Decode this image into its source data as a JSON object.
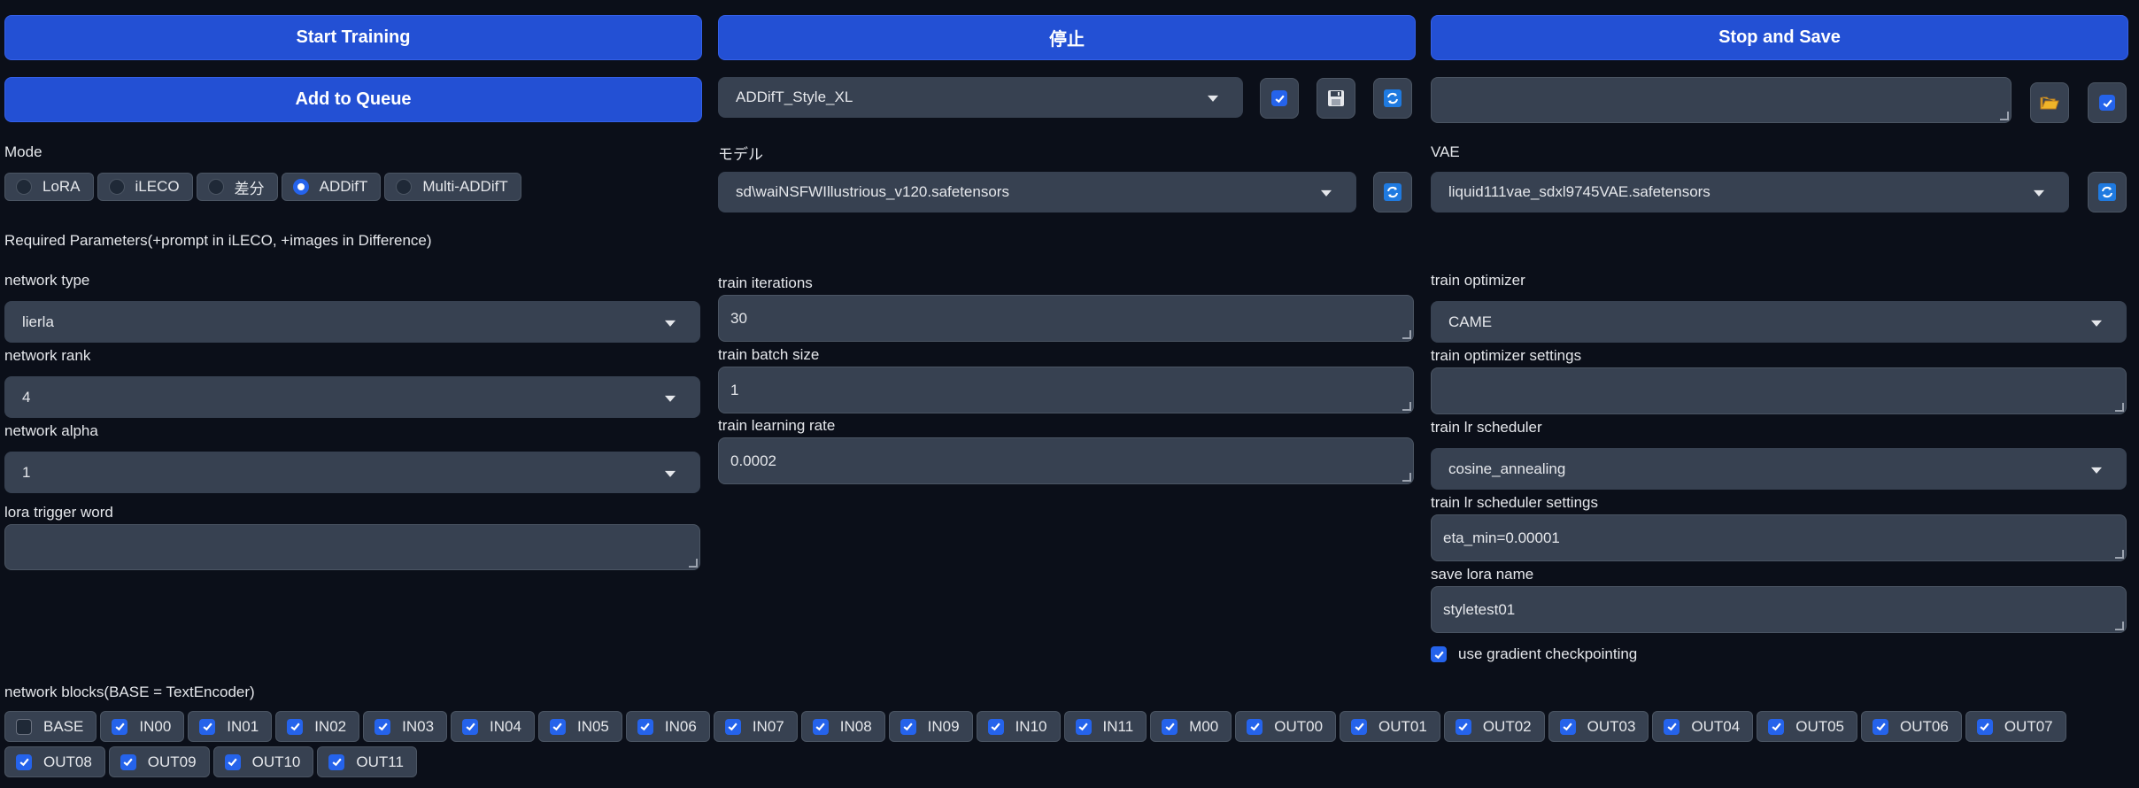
{
  "top_buttons": {
    "start": "Start Training",
    "stop": "停止",
    "stop_save": "Stop and Save",
    "queue": "Add to Queue"
  },
  "preset": {
    "value": "ADDifT_Style_XL"
  },
  "preset_text": {
    "value": ""
  },
  "mode": {
    "label": "Mode",
    "options": [
      "LoRA",
      "iLECO",
      "差分",
      "ADDifT",
      "Multi-ADDifT"
    ],
    "selected": "ADDifT"
  },
  "model": {
    "label": "モデル",
    "value": "sd\\waiNSFWIllustrious_v120.safetensors"
  },
  "vae": {
    "label": "VAE",
    "value": "liquid111vae_sdxl9745VAE.safetensors"
  },
  "required_heading": "Required Parameters(+prompt in iLECO, +images in Difference)",
  "left": {
    "network_type": {
      "label": "network type",
      "value": "lierla"
    },
    "network_rank": {
      "label": "network rank",
      "value": "4"
    },
    "network_alpha": {
      "label": "network alpha",
      "value": "1"
    },
    "lora_trigger": {
      "label": "lora trigger word",
      "value": ""
    }
  },
  "middle": {
    "iterations": {
      "label": "train iterations",
      "value": "30"
    },
    "batch": {
      "label": "train batch size",
      "value": "1"
    },
    "lr": {
      "label": "train learning rate",
      "value": "0.0002"
    }
  },
  "right": {
    "optimizer": {
      "label": "train optimizer",
      "value": "CAME"
    },
    "optimizer_settings": {
      "label": "train optimizer settings",
      "value": ""
    },
    "scheduler": {
      "label": "train lr scheduler",
      "value": "cosine_annealing"
    },
    "scheduler_settings": {
      "label": "train lr scheduler settings",
      "value": "eta_min=0.00001"
    },
    "save_name": {
      "label": "save lora name",
      "value": "styletest01"
    },
    "gradient_ckpt": {
      "label": "use gradient checkpointing",
      "checked": true
    }
  },
  "blocks": {
    "label": "network blocks(BASE = TextEncoder)",
    "items": [
      {
        "name": "BASE",
        "checked": false
      },
      {
        "name": "IN00",
        "checked": true
      },
      {
        "name": "IN01",
        "checked": true
      },
      {
        "name": "IN02",
        "checked": true
      },
      {
        "name": "IN03",
        "checked": true
      },
      {
        "name": "IN04",
        "checked": true
      },
      {
        "name": "IN05",
        "checked": true
      },
      {
        "name": "IN06",
        "checked": true
      },
      {
        "name": "IN07",
        "checked": true
      },
      {
        "name": "IN08",
        "checked": true
      },
      {
        "name": "IN09",
        "checked": true
      },
      {
        "name": "IN10",
        "checked": true
      },
      {
        "name": "IN11",
        "checked": true
      },
      {
        "name": "M00",
        "checked": true
      },
      {
        "name": "OUT00",
        "checked": true
      },
      {
        "name": "OUT01",
        "checked": true
      },
      {
        "name": "OUT02",
        "checked": true
      },
      {
        "name": "OUT03",
        "checked": true
      },
      {
        "name": "OUT04",
        "checked": true
      },
      {
        "name": "OUT05",
        "checked": true
      },
      {
        "name": "OUT06",
        "checked": true
      },
      {
        "name": "OUT07",
        "checked": true
      },
      {
        "name": "OUT08",
        "checked": true
      },
      {
        "name": "OUT09",
        "checked": true
      },
      {
        "name": "OUT10",
        "checked": true
      },
      {
        "name": "OUT11",
        "checked": true
      }
    ]
  },
  "icons": {
    "checkbox": "checkbox-icon",
    "save": "floppy-disk-icon",
    "refresh": "refresh-icon",
    "folder": "folder-open-icon"
  },
  "colors": {
    "accent": "#2350d4",
    "background": "#0b0f19",
    "field": "#374151"
  }
}
